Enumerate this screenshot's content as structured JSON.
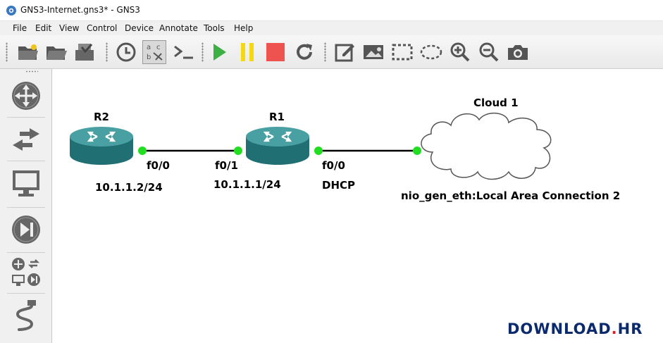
{
  "window": {
    "title": "GNS3-Internet.gns3* - GNS3"
  },
  "menu": {
    "file": "File",
    "edit": "Edit",
    "view": "View",
    "control": "Control",
    "device": "Device",
    "annotate": "Annotate",
    "tools": "Tools",
    "help": "Help"
  },
  "toolbar": {
    "icons": [
      "new-project-icon",
      "open-project-icon",
      "save-project-icon",
      "snapshot-icon",
      "show-interface-labels-icon",
      "console-icon",
      "start-icon",
      "suspend-icon",
      "stop-icon",
      "reload-icon",
      "add-note-icon",
      "insert-picture-icon",
      "draw-rectangle-icon",
      "draw-ellipse-icon",
      "zoom-in-icon",
      "zoom-out-icon",
      "screenshot-icon"
    ]
  },
  "sidebar": {
    "icons": [
      "routers-icon",
      "switches-icon",
      "end-devices-icon",
      "security-devices-icon",
      "all-devices-icon",
      "add-link-icon"
    ]
  },
  "topology": {
    "nodes": {
      "r2": {
        "name": "R2"
      },
      "r1": {
        "name": "R1"
      },
      "cloud": {
        "name": "Cloud 1"
      }
    },
    "labels": {
      "r2_port": "f0/0",
      "r2_ip": "10.1.1.2/24",
      "r1_port_left": "f0/1",
      "r1_ip": "10.1.1.1/24",
      "r1_port_right": "f0/0",
      "r1_mode": "DHCP",
      "cloud_iface": "nio_gen_eth:Local Area Connection 2"
    },
    "colors": {
      "router": "#2e8a8d",
      "port_up": "#22dd22",
      "link": "#000000"
    }
  },
  "watermark": {
    "part1": "DOWNLOAD",
    "sep": ".",
    "part2": "HR"
  }
}
